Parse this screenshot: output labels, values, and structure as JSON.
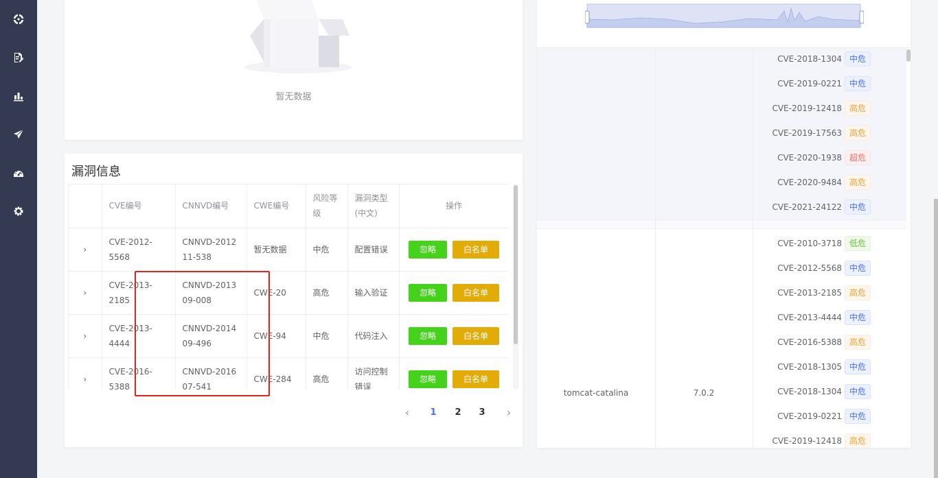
{
  "empty": {
    "text": "暂无数据"
  },
  "vuln": {
    "title": "漏洞信息",
    "columns": [
      "CVE编号",
      "CNNVD编号",
      "CWE编号",
      "风险等级",
      "漏洞类型(中文)",
      "操作"
    ],
    "rows": [
      {
        "cve": "CVE-2012-5568",
        "cnnvd": "CNNVD-201211-538",
        "cwe": "暂无数据",
        "risk": "中危",
        "type": "配置错误"
      },
      {
        "cve": "CVE-2013-2185",
        "cnnvd": "CNNVD-201309-008",
        "cwe": "CWE-20",
        "risk": "高危",
        "type": "输入验证"
      },
      {
        "cve": "CVE-2013-4444",
        "cnnvd": "CNNVD-201409-496",
        "cwe": "CWE-94",
        "risk": "中危",
        "type": "代码注入"
      },
      {
        "cve": "CVE-2016-5388",
        "cnnvd": "CNNVD-201607-541",
        "cwe": "CWE-284",
        "risk": "高危",
        "type": "访问控制错误"
      }
    ],
    "ignore_label": "忽略",
    "whitelist_label": "白名单",
    "pages": [
      "1",
      "2",
      "3"
    ],
    "prev": "‹",
    "next": "›"
  },
  "right": {
    "group1": [
      {
        "id": "CVE-2018-1304",
        "level": "中危"
      },
      {
        "id": "CVE-2019-0221",
        "level": "中危"
      },
      {
        "id": "CVE-2019-12418",
        "level": "高危"
      },
      {
        "id": "CVE-2019-17563",
        "level": "高危"
      },
      {
        "id": "CVE-2020-1938",
        "level": "超危"
      },
      {
        "id": "CVE-2020-9484",
        "level": "高危"
      },
      {
        "id": "CVE-2021-24122",
        "level": "中危"
      }
    ],
    "component": "tomcat-catalina",
    "version": "7.0.2",
    "group2": [
      {
        "id": "CVE-2010-3718",
        "level": "低危"
      },
      {
        "id": "CVE-2012-5568",
        "level": "中危"
      },
      {
        "id": "CVE-2013-2185",
        "level": "高危"
      },
      {
        "id": "CVE-2013-4444",
        "level": "中危"
      },
      {
        "id": "CVE-2016-5388",
        "level": "高危"
      },
      {
        "id": "CVE-2018-1305",
        "level": "中危"
      },
      {
        "id": "CVE-2018-1304",
        "level": "中危"
      },
      {
        "id": "CVE-2019-0221",
        "level": "中危"
      },
      {
        "id": "CVE-2019-12418",
        "level": "高危"
      }
    ]
  },
  "colors": {
    "sidebar": "#333a52",
    "accent": "#4e6ef2",
    "ignore": "#44d21a",
    "whitelist": "#e3ab08",
    "highlight": "#e8211c"
  }
}
